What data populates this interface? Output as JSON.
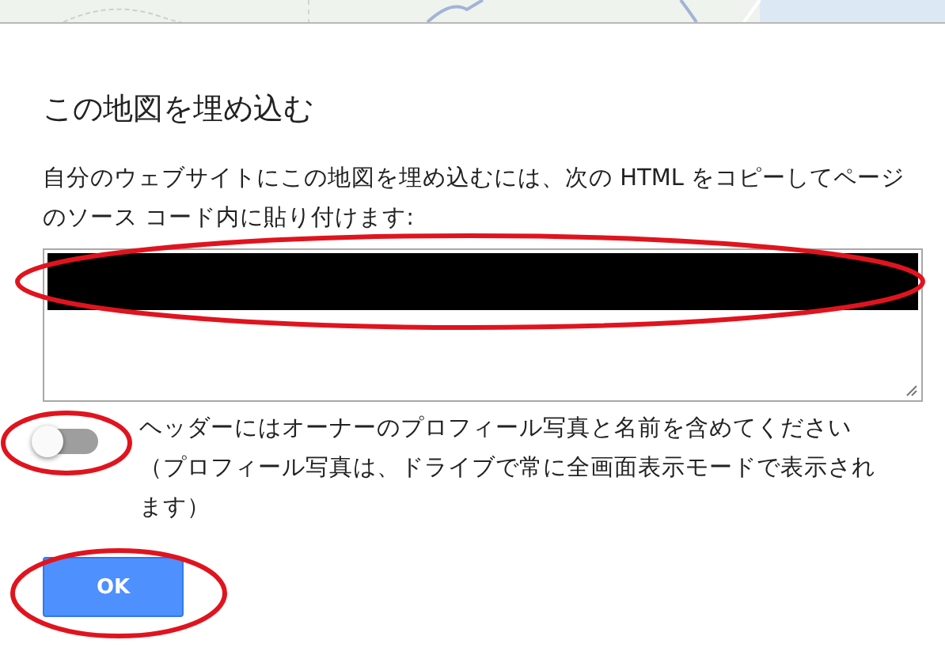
{
  "dialog": {
    "title": "この地図を埋め込む",
    "description": "自分のウェブサイトにこの地図を埋め込むには、次の HTML をコピーしてページのソース コード内に貼り付けます:",
    "code_field": {
      "redacted": true
    },
    "header_toggle": {
      "on": false,
      "label": "ヘッダーにはオーナーのプロフィール写真と名前を含めてください（プロフィール写真は、ドライブで常に全画面表示モードで表示されます）"
    },
    "buttons": [
      {
        "label": "OK",
        "kind": "primary"
      }
    ]
  }
}
